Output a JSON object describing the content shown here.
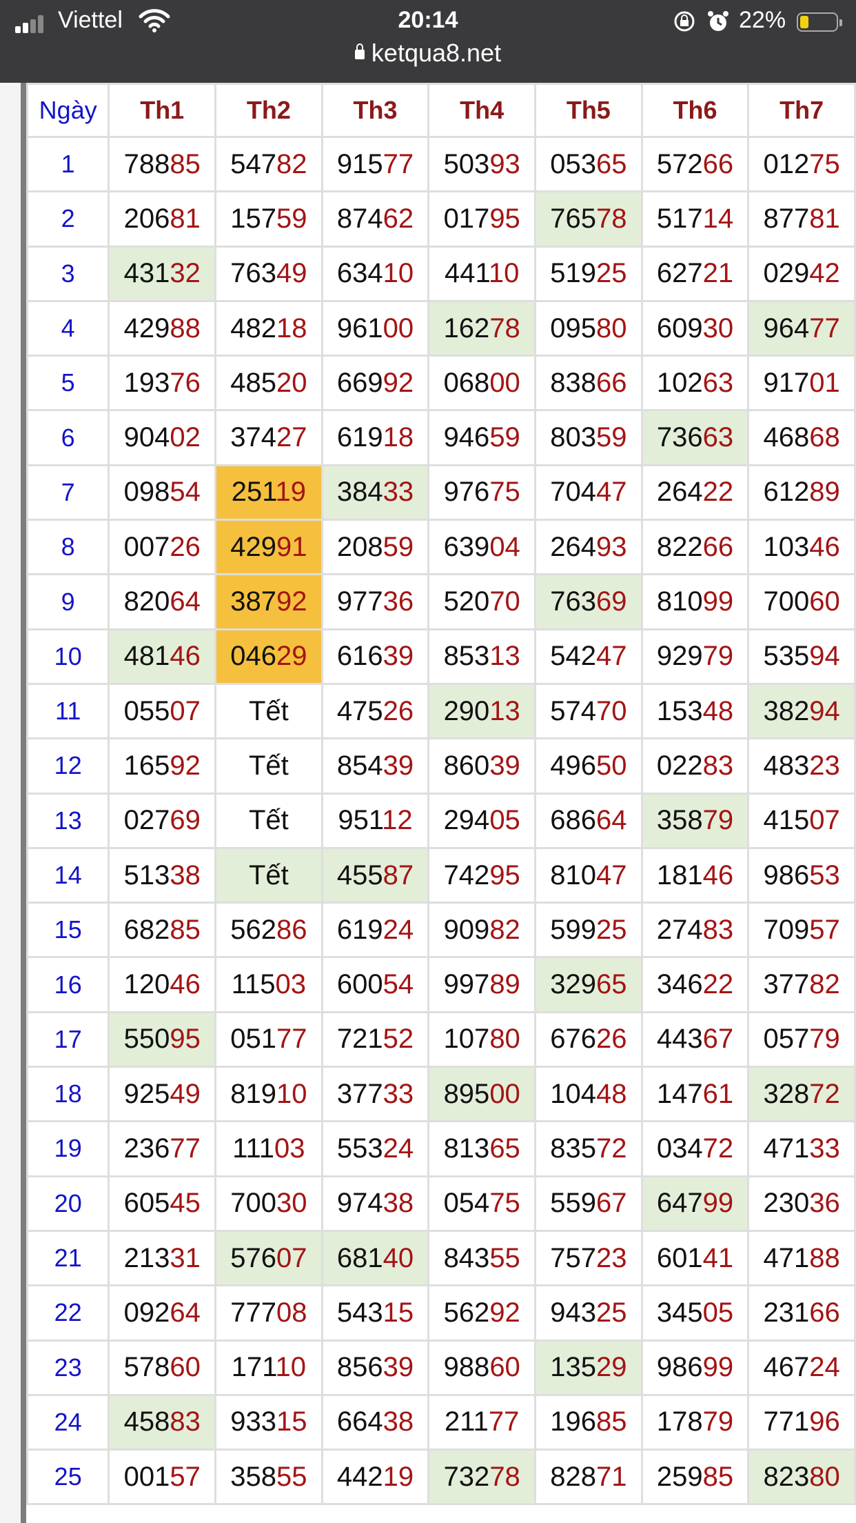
{
  "status_bar": {
    "carrier": "Viettel",
    "time": "20:14",
    "battery_percent": "22%",
    "battery_level": 0.22,
    "icons": [
      "signal-icon",
      "wifi-icon",
      "rotation-lock-icon",
      "alarm-icon",
      "battery-icon"
    ]
  },
  "browser": {
    "url": "ketqua8.net"
  },
  "table": {
    "headers": [
      "Ngày",
      "Th1",
      "Th2",
      "Th3",
      "Th4",
      "Th5",
      "Th6",
      "Th7"
    ],
    "rows": [
      {
        "day": "1",
        "cells": [
          {
            "v": "78885"
          },
          {
            "v": "54782"
          },
          {
            "v": "91577"
          },
          {
            "v": "50393"
          },
          {
            "v": "05365"
          },
          {
            "v": "57266"
          },
          {
            "v": "01275"
          }
        ]
      },
      {
        "day": "2",
        "cells": [
          {
            "v": "20681"
          },
          {
            "v": "15759"
          },
          {
            "v": "87462"
          },
          {
            "v": "01795"
          },
          {
            "v": "76578",
            "hl": "green"
          },
          {
            "v": "51714"
          },
          {
            "v": "87781"
          }
        ]
      },
      {
        "day": "3",
        "cells": [
          {
            "v": "43132",
            "hl": "green"
          },
          {
            "v": "76349"
          },
          {
            "v": "63410"
          },
          {
            "v": "44110"
          },
          {
            "v": "51925"
          },
          {
            "v": "62721"
          },
          {
            "v": "02942"
          }
        ]
      },
      {
        "day": "4",
        "cells": [
          {
            "v": "42988"
          },
          {
            "v": "48218"
          },
          {
            "v": "96100"
          },
          {
            "v": "16278",
            "hl": "green"
          },
          {
            "v": "09580"
          },
          {
            "v": "60930"
          },
          {
            "v": "96477",
            "hl": "green"
          }
        ]
      },
      {
        "day": "5",
        "cells": [
          {
            "v": "19376"
          },
          {
            "v": "48520"
          },
          {
            "v": "66992"
          },
          {
            "v": "06800"
          },
          {
            "v": "83866"
          },
          {
            "v": "10263"
          },
          {
            "v": "91701"
          }
        ]
      },
      {
        "day": "6",
        "cells": [
          {
            "v": "90402"
          },
          {
            "v": "37427"
          },
          {
            "v": "61918"
          },
          {
            "v": "94659"
          },
          {
            "v": "80359"
          },
          {
            "v": "73663",
            "hl": "green"
          },
          {
            "v": "46868"
          }
        ]
      },
      {
        "day": "7",
        "cells": [
          {
            "v": "09854"
          },
          {
            "v": "25119",
            "hl": "orange"
          },
          {
            "v": "38433",
            "hl": "green"
          },
          {
            "v": "97675"
          },
          {
            "v": "70447"
          },
          {
            "v": "26422"
          },
          {
            "v": "61289"
          }
        ]
      },
      {
        "day": "8",
        "cells": [
          {
            "v": "00726"
          },
          {
            "v": "42991",
            "hl": "orange"
          },
          {
            "v": "20859"
          },
          {
            "v": "63904"
          },
          {
            "v": "26493"
          },
          {
            "v": "82266"
          },
          {
            "v": "10346"
          }
        ]
      },
      {
        "day": "9",
        "cells": [
          {
            "v": "82064"
          },
          {
            "v": "38792",
            "hl": "orange"
          },
          {
            "v": "97736"
          },
          {
            "v": "52070"
          },
          {
            "v": "76369",
            "hl": "green"
          },
          {
            "v": "81099"
          },
          {
            "v": "70060"
          }
        ]
      },
      {
        "day": "10",
        "cells": [
          {
            "v": "48146",
            "hl": "green"
          },
          {
            "v": "04629",
            "hl": "orange"
          },
          {
            "v": "61639"
          },
          {
            "v": "85313"
          },
          {
            "v": "54247"
          },
          {
            "v": "92979"
          },
          {
            "v": "53594"
          }
        ]
      },
      {
        "day": "11",
        "cells": [
          {
            "v": "05507"
          },
          {
            "v": "Tết"
          },
          {
            "v": "47526"
          },
          {
            "v": "29013",
            "hl": "green"
          },
          {
            "v": "57470"
          },
          {
            "v": "15348"
          },
          {
            "v": "38294",
            "hl": "green"
          }
        ]
      },
      {
        "day": "12",
        "cells": [
          {
            "v": "16592"
          },
          {
            "v": "Tết"
          },
          {
            "v": "85439"
          },
          {
            "v": "86039"
          },
          {
            "v": "49650"
          },
          {
            "v": "02283"
          },
          {
            "v": "48323"
          }
        ]
      },
      {
        "day": "13",
        "cells": [
          {
            "v": "02769"
          },
          {
            "v": "Tết"
          },
          {
            "v": "95112"
          },
          {
            "v": "29405"
          },
          {
            "v": "68664"
          },
          {
            "v": "35879",
            "hl": "green"
          },
          {
            "v": "41507"
          }
        ]
      },
      {
        "day": "14",
        "cells": [
          {
            "v": "51338"
          },
          {
            "v": "Tết",
            "hl": "green"
          },
          {
            "v": "45587",
            "hl": "green"
          },
          {
            "v": "74295"
          },
          {
            "v": "81047"
          },
          {
            "v": "18146"
          },
          {
            "v": "98653"
          }
        ]
      },
      {
        "day": "15",
        "cells": [
          {
            "v": "68285"
          },
          {
            "v": "56286"
          },
          {
            "v": "61924"
          },
          {
            "v": "90982"
          },
          {
            "v": "59925"
          },
          {
            "v": "27483"
          },
          {
            "v": "70957"
          }
        ]
      },
      {
        "day": "16",
        "cells": [
          {
            "v": "12046"
          },
          {
            "v": "11503"
          },
          {
            "v": "60054"
          },
          {
            "v": "99789"
          },
          {
            "v": "32965",
            "hl": "green"
          },
          {
            "v": "34622"
          },
          {
            "v": "37782"
          }
        ]
      },
      {
        "day": "17",
        "cells": [
          {
            "v": "55095",
            "hl": "green"
          },
          {
            "v": "05177"
          },
          {
            "v": "72152"
          },
          {
            "v": "10780"
          },
          {
            "v": "67626"
          },
          {
            "v": "44367"
          },
          {
            "v": "05779"
          }
        ]
      },
      {
        "day": "18",
        "cells": [
          {
            "v": "92549"
          },
          {
            "v": "81910"
          },
          {
            "v": "37733"
          },
          {
            "v": "89500",
            "hl": "green"
          },
          {
            "v": "10448"
          },
          {
            "v": "14761"
          },
          {
            "v": "32872",
            "hl": "green"
          }
        ]
      },
      {
        "day": "19",
        "cells": [
          {
            "v": "23677"
          },
          {
            "v": "11103"
          },
          {
            "v": "55324"
          },
          {
            "v": "81365"
          },
          {
            "v": "83572"
          },
          {
            "v": "03472"
          },
          {
            "v": "47133"
          }
        ]
      },
      {
        "day": "20",
        "cells": [
          {
            "v": "60545"
          },
          {
            "v": "70030"
          },
          {
            "v": "97438"
          },
          {
            "v": "05475"
          },
          {
            "v": "55967"
          },
          {
            "v": "64799",
            "hl": "green"
          },
          {
            "v": "23036"
          }
        ]
      },
      {
        "day": "21",
        "cells": [
          {
            "v": "21331"
          },
          {
            "v": "57607",
            "hl": "green"
          },
          {
            "v": "68140",
            "hl": "green"
          },
          {
            "v": "84355"
          },
          {
            "v": "75723"
          },
          {
            "v": "60141"
          },
          {
            "v": "47188"
          }
        ]
      },
      {
        "day": "22",
        "cells": [
          {
            "v": "09264"
          },
          {
            "v": "77708"
          },
          {
            "v": "54315"
          },
          {
            "v": "56292"
          },
          {
            "v": "94325"
          },
          {
            "v": "34505"
          },
          {
            "v": "23166"
          }
        ]
      },
      {
        "day": "23",
        "cells": [
          {
            "v": "57860"
          },
          {
            "v": "17110"
          },
          {
            "v": "85639"
          },
          {
            "v": "98860"
          },
          {
            "v": "13529",
            "hl": "green"
          },
          {
            "v": "98699"
          },
          {
            "v": "46724"
          }
        ]
      },
      {
        "day": "24",
        "cells": [
          {
            "v": "45883",
            "hl": "green"
          },
          {
            "v": "93315"
          },
          {
            "v": "66438"
          },
          {
            "v": "21177"
          },
          {
            "v": "19685"
          },
          {
            "v": "17879"
          },
          {
            "v": "77196"
          }
        ]
      },
      {
        "day": "25",
        "cells": [
          {
            "v": "00157"
          },
          {
            "v": "35855"
          },
          {
            "v": "44219"
          },
          {
            "v": "73278",
            "hl": "green"
          },
          {
            "v": "82871"
          },
          {
            "v": "25985"
          },
          {
            "v": "82380",
            "hl": "green"
          }
        ]
      }
    ]
  },
  "colors": {
    "header_day": "#1414c8",
    "header_weekday": "#8b1a1a",
    "tail_digits": "#a31414",
    "highlight_green": "#e3eed9",
    "highlight_orange": "#f4c03e"
  }
}
